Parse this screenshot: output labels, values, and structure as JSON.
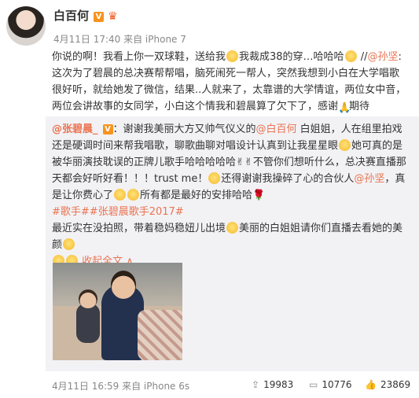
{
  "post": {
    "author": "白百何",
    "v_badge": "V",
    "crown": "♛",
    "meta": "4月11日 17:40 来自 iPhone 7",
    "text_1": "你说的啊！我看上你一双球鞋，送给我",
    "text_2": "我裁成38的穿…哈哈哈",
    "text_3": " //",
    "mention_1": "@孙坚",
    "text_4": ":这次为了碧晨的总决赛帮帮唱，脑死闹死一帮人，突然我想到小白在大学唱歌很好听，就给她发了微信，结果..人就来了，太靠谱的大学情谊，两位女中音，两位会讲故事的女同学，小白这个情我和碧晨算了欠下了，感谢",
    "text_5": "期待"
  },
  "repost": {
    "author": "@张碧晨_",
    "v_badge": "V",
    "line_1": "：谢谢我美丽大方又帅气仪义的",
    "mention_1": "@白百何",
    "line_2": " 白姐姐，人在组里拍戏还是硬调时间来帮我唱歌，聊歌曲聊对唱设计认真到让我星星眼",
    "line_3": "她可真的是被华丽演技耽误的正牌儿歌手哈哈哈哈哈",
    "line_4": "不管你们想听什么，总决赛直播那天都会好听好看！！！trust me！",
    "line_5": "还得谢谢我操碎了心的合伙人",
    "mention_2": "@孙坚",
    "line_6": "，真是让你费心了",
    "line_7": "所有都是最好的安排哈哈",
    "hashtag_1": "#歌手#",
    "hashtag_2": "#张碧晨歌手2017#",
    "line_8": "最近实在没拍照，带着稳妈稳妞儿出境",
    "line_9": "美丽的白姐姐请你们直播去看她的美颜",
    "collapse": "收起全文",
    "collapse_arrow": "∧",
    "footer_meta": "4月11日 16:59 来自 iPhone 6s",
    "reposts": "19983",
    "comments": "10776",
    "likes": "23869",
    "icon_repost": "repost-icon",
    "icon_comment": "comment-icon",
    "icon_like": "like-icon"
  },
  "colors": {
    "link": "#eb7350",
    "repost_bg": "#f2f2f5",
    "meta": "#888888"
  }
}
